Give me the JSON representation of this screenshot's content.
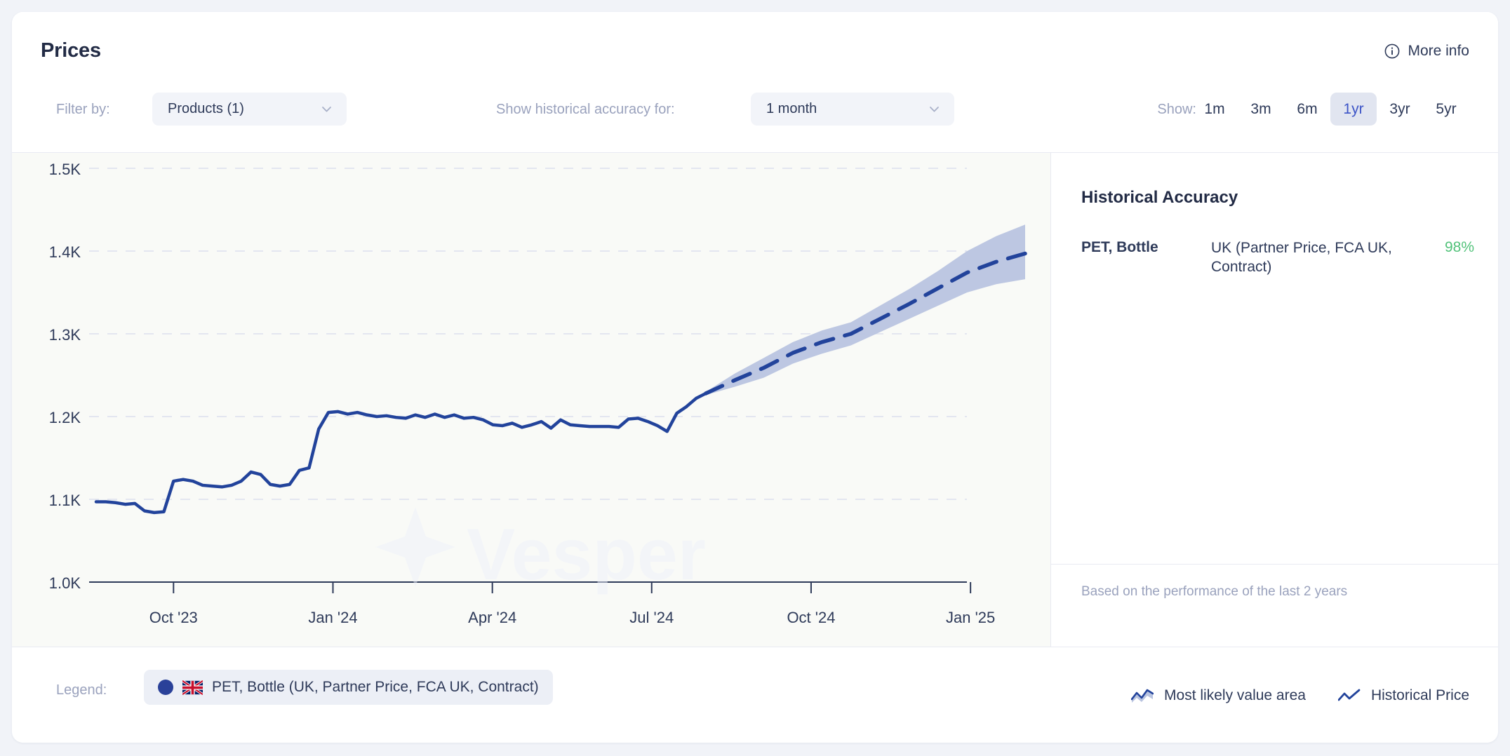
{
  "header": {
    "title": "Prices",
    "more_info": {
      "label": "More info",
      "icon": "info-circle-icon"
    },
    "filter_label": "Filter by:",
    "products_select": {
      "value": "Products (1)",
      "chevron": "chevron-down-icon"
    },
    "accuracy_label": "Show historical accuracy for:",
    "period_select": {
      "value": "1 month",
      "chevron": "chevron-down-icon"
    },
    "show_label": "Show:",
    "ranges": [
      {
        "label": "1m",
        "active": false
      },
      {
        "label": "3m",
        "active": false
      },
      {
        "label": "6m",
        "active": false
      },
      {
        "label": "1yr",
        "active": true
      },
      {
        "label": "3yr",
        "active": false
      },
      {
        "label": "5yr",
        "active": false
      }
    ]
  },
  "sidebar": {
    "title": "Historical Accuracy",
    "row": {
      "name": "PET, Bottle",
      "description": "UK (Partner Price, FCA UK, Contract)",
      "accuracy": "98%"
    },
    "footnote": "Based on the performance of the last 2 years"
  },
  "legend": {
    "label": "Legend:",
    "series_chip": {
      "text": "PET, Bottle (UK, Partner Price, FCA UK, Contract)",
      "dot_color": "#2a4199",
      "flag": "uk-flag-icon"
    },
    "keys": [
      {
        "label": "Most likely value area",
        "icon": "forecast-band-icon"
      },
      {
        "label": "Historical Price",
        "icon": "line-chart-icon"
      }
    ]
  },
  "watermark": "Vesper",
  "colors": {
    "line": "#22439b",
    "band": "#b9c4e0",
    "accent": "#3d55c7",
    "accuracy_green": "#52c27a",
    "grid": "#e3e6f0",
    "chart_bg": "#f9faf7"
  },
  "chart_data": {
    "type": "line",
    "title": "Prices",
    "xlabel": "",
    "ylabel": "",
    "ylim": [
      1000,
      1500
    ],
    "yticks": [
      1000,
      1100,
      1200,
      1300,
      1400,
      1500
    ],
    "ytick_labels": [
      "1.0K",
      "1.1K",
      "1.2K",
      "1.3K",
      "1.4K",
      "1.5K"
    ],
    "xticks": [
      "Oct '23",
      "Jan '24",
      "Apr '24",
      "Jul '24",
      "Oct '24",
      "Jan '25"
    ],
    "xtick_positions": [
      0.0833,
      0.2549,
      0.4265,
      0.598,
      0.7696,
      0.9412
    ],
    "xlim": [
      0,
      1
    ],
    "grid": true,
    "legend_position": "bottom",
    "series": [
      {
        "name": "Historical Price",
        "style": "solid",
        "color": "#22439b",
        "points": [
          [
            0.0,
            1097
          ],
          [
            0.0104,
            1097
          ],
          [
            0.0208,
            1096
          ],
          [
            0.0313,
            1094
          ],
          [
            0.0417,
            1095
          ],
          [
            0.0521,
            1086
          ],
          [
            0.0625,
            1084
          ],
          [
            0.0729,
            1085
          ],
          [
            0.0833,
            1122
          ],
          [
            0.0937,
            1124
          ],
          [
            0.1042,
            1122
          ],
          [
            0.1146,
            1117
          ],
          [
            0.125,
            1116
          ],
          [
            0.1354,
            1115
          ],
          [
            0.1458,
            1117
          ],
          [
            0.1562,
            1122
          ],
          [
            0.1667,
            1133
          ],
          [
            0.1771,
            1130
          ],
          [
            0.1875,
            1118
          ],
          [
            0.1979,
            1116
          ],
          [
            0.2083,
            1118
          ],
          [
            0.2188,
            1135
          ],
          [
            0.2292,
            1138
          ],
          [
            0.2396,
            1185
          ],
          [
            0.25,
            1205
          ],
          [
            0.2604,
            1206
          ],
          [
            0.2708,
            1203
          ],
          [
            0.2812,
            1205
          ],
          [
            0.2917,
            1202
          ],
          [
            0.3021,
            1200
          ],
          [
            0.3125,
            1201
          ],
          [
            0.3229,
            1199
          ],
          [
            0.3333,
            1198
          ],
          [
            0.3437,
            1202
          ],
          [
            0.3542,
            1199
          ],
          [
            0.3646,
            1203
          ],
          [
            0.375,
            1199
          ],
          [
            0.3854,
            1202
          ],
          [
            0.3958,
            1198
          ],
          [
            0.4062,
            1199
          ],
          [
            0.4167,
            1196
          ],
          [
            0.4271,
            1190
          ],
          [
            0.4375,
            1189
          ],
          [
            0.4479,
            1192
          ],
          [
            0.4583,
            1187
          ],
          [
            0.4688,
            1190
          ],
          [
            0.4792,
            1194
          ],
          [
            0.4896,
            1186
          ],
          [
            0.5,
            1196
          ],
          [
            0.5104,
            1190
          ],
          [
            0.5208,
            1189
          ],
          [
            0.5312,
            1188
          ],
          [
            0.5417,
            1188
          ],
          [
            0.5521,
            1188
          ],
          [
            0.5625,
            1187
          ],
          [
            0.5729,
            1197
          ],
          [
            0.5833,
            1198
          ],
          [
            0.5938,
            1194
          ],
          [
            0.6042,
            1189
          ],
          [
            0.6146,
            1182
          ],
          [
            0.625,
            1204
          ],
          [
            0.6354,
            1212
          ],
          [
            0.6458,
            1222
          ],
          [
            0.6562,
            1228
          ]
        ]
      },
      {
        "name": "Forecast",
        "style": "dashed",
        "color": "#22439b",
        "points": [
          [
            0.6562,
            1228
          ],
          [
            0.6875,
            1244
          ],
          [
            0.7188,
            1259
          ],
          [
            0.75,
            1277
          ],
          [
            0.7812,
            1290
          ],
          [
            0.8125,
            1300
          ],
          [
            0.8437,
            1318
          ],
          [
            0.875,
            1336
          ],
          [
            0.9062,
            1355
          ],
          [
            0.9375,
            1374
          ],
          [
            0.9688,
            1387
          ],
          [
            1.0,
            1397
          ]
        ]
      }
    ],
    "band": {
      "name": "Most likely value area",
      "color": "#b9c4e0",
      "upper": [
        [
          0.6562,
          1230
        ],
        [
          0.6875,
          1252
        ],
        [
          0.7188,
          1271
        ],
        [
          0.75,
          1290
        ],
        [
          0.7812,
          1304
        ],
        [
          0.8125,
          1314
        ],
        [
          0.8437,
          1334
        ],
        [
          0.875,
          1354
        ],
        [
          0.9062,
          1376
        ],
        [
          0.9375,
          1400
        ],
        [
          0.9688,
          1418
        ],
        [
          1.0,
          1432
        ]
      ],
      "lower": [
        [
          0.6562,
          1226
        ],
        [
          0.6875,
          1236
        ],
        [
          0.7188,
          1247
        ],
        [
          0.75,
          1264
        ],
        [
          0.7812,
          1276
        ],
        [
          0.8125,
          1286
        ],
        [
          0.8437,
          1302
        ],
        [
          0.875,
          1318
        ],
        [
          0.9062,
          1334
        ],
        [
          0.9375,
          1350
        ],
        [
          0.9688,
          1360
        ],
        [
          1.0,
          1366
        ]
      ]
    }
  }
}
